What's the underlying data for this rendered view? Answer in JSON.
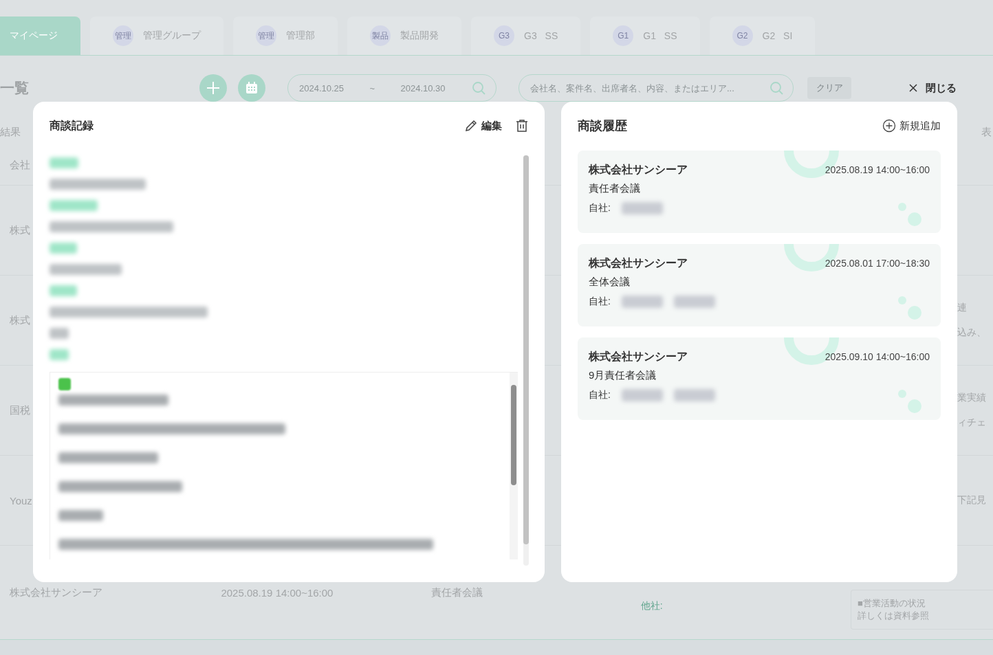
{
  "tabs": [
    {
      "label": "マイページ",
      "selected": true
    },
    {
      "badge": "管理",
      "label": "管理グループ",
      "selected": false
    },
    {
      "badge": "管理",
      "label": "管理部",
      "selected": false
    },
    {
      "badge": "製品",
      "label": "製品開発",
      "selected": false
    },
    {
      "badge": "G3",
      "label": "G3 SS",
      "selected": false
    },
    {
      "badge": "G1",
      "label": "G1 SS",
      "selected": false
    },
    {
      "badge": "G2",
      "label": "G2 SI",
      "selected": false
    }
  ],
  "toolbar": {
    "page_title": "一覧",
    "date_from": "2024.10.25",
    "date_separator": "~",
    "date_to": "2024.10.30",
    "search_placeholder": "会社名、案件名、出席者名、内容、またはエリア...",
    "clear_button": "クリア",
    "close_button": "閉じる"
  },
  "results_label": "結果",
  "right_fragment": "表",
  "table": {
    "header": "会社",
    "rows": [
      {
        "company": "株式",
        "fragments": []
      },
      {
        "company": "株式",
        "fragments": [
          "連",
          "込み、"
        ]
      },
      {
        "company": "国税",
        "fragments": [
          "業実績",
          "ィチェ"
        ]
      },
      {
        "company": "Youz",
        "fragments": [
          "下記見"
        ]
      }
    ],
    "last_row": {
      "company": "株式会社サンシーア",
      "datetime": "2025.08.19 14:00~16:00",
      "title": "責任者会議",
      "other_label": "他社:",
      "note": [
        "■営業活動の状況",
        "詳しくは資料参照"
      ]
    }
  },
  "record_panel": {
    "title": "商談記録",
    "edit_button": "編集"
  },
  "history_panel": {
    "title": "商談履歴",
    "add_button": "新規追加",
    "items": [
      {
        "company": "株式会社サンシーア",
        "datetime": "2025.08.19 14:00~16:00",
        "title": "責任者会議",
        "own_label": "自社:"
      },
      {
        "company": "株式会社サンシーア",
        "datetime": "2025.08.01 17:00~18:30",
        "title": "全体会議",
        "own_label": "自社:"
      },
      {
        "company": "株式会社サンシーア",
        "datetime": "2025.09.10 14:00~16:00",
        "title": "9月責任者会議",
        "own_label": "自社:"
      }
    ]
  }
}
